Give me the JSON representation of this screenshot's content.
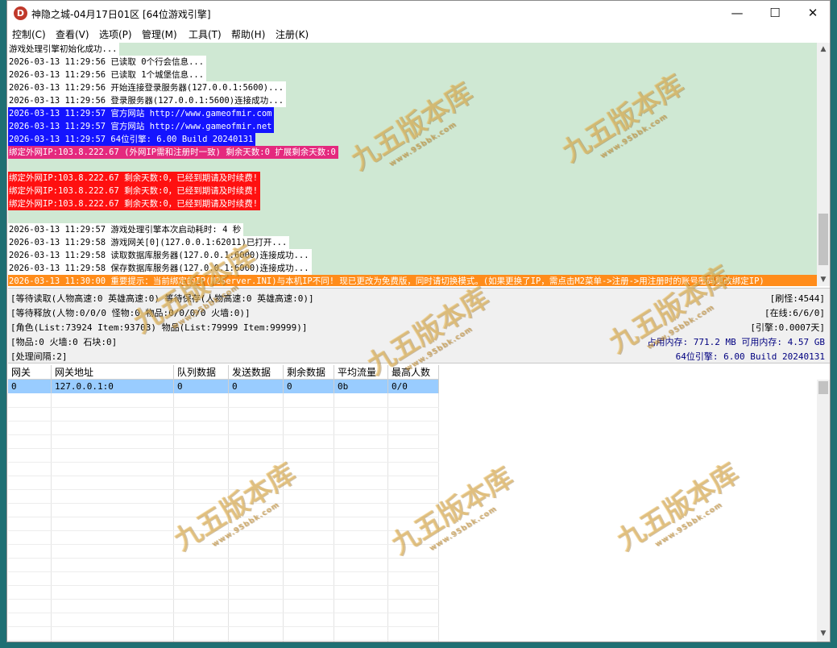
{
  "window": {
    "icon_letter": "D",
    "title": "神隐之城-04月17日01区 [64位游戏引擎]",
    "minimize": "—",
    "maximize": "☐",
    "close": "✕"
  },
  "menu": [
    "控制(C)",
    "查看(V)",
    "选项(P)",
    "管理(M)",
    "工具(T)",
    "帮助(H)",
    "注册(K)"
  ],
  "log_lines": [
    {
      "text": "游戏处理引擎初始化成功...",
      "style": "white"
    },
    {
      "text": "2026-03-13 11:29:56 已读取 0个行会信息...",
      "style": "white"
    },
    {
      "text": "2026-03-13 11:29:56 已读取 1个城堡信息...",
      "style": "white"
    },
    {
      "text": "2026-03-13 11:29:56 开始连接登录服务器(127.0.0.1:5600)...",
      "style": "white"
    },
    {
      "text": "2026-03-13 11:29:56 登录服务器(127.0.0.1:5600)连接成功...",
      "style": "white"
    },
    {
      "text": "2026-03-13 11:29:57 官方网站 http://www.gameofmir.com",
      "style": "blue"
    },
    {
      "text": "2026-03-13 11:29:57 官方网站 http://www.gameofmir.net",
      "style": "blue"
    },
    {
      "text": "2026-03-13 11:29:57 64位引擎: 6.00 Build 20240131",
      "style": "blue"
    },
    {
      "text": "绑定外网IP:103.8.222.67 (外网IP需和注册时一致) 剩余天数:0 扩展剩余天数:0",
      "style": "magenta"
    },
    {
      "text": "",
      "style": "none"
    },
    {
      "text": "绑定外网IP:103.8.222.67 剩余天数:0，已经到期请及时续费!",
      "style": "red"
    },
    {
      "text": "绑定外网IP:103.8.222.67 剩余天数:0，已经到期请及时续费!",
      "style": "red"
    },
    {
      "text": "绑定外网IP:103.8.222.67 剩余天数:0，已经到期请及时续费!",
      "style": "red"
    },
    {
      "text": "",
      "style": "none"
    },
    {
      "text": "2026-03-13 11:29:57 游戏处理引擎本次启动耗时: 4 秒",
      "style": "white"
    },
    {
      "text": "2026-03-13 11:29:58 游戏网关[0](127.0.0.1:62011)已打开...",
      "style": "white"
    },
    {
      "text": "2026-03-13 11:29:58 读取数据库服务器(127.0.0.1:6000)连接成功...",
      "style": "white"
    },
    {
      "text": "2026-03-13 11:29:58 保存数据库服务器(127.0.0.1:6000)连接成功...",
      "style": "white"
    },
    {
      "text": "2026-03-13 11:30:00 重要提示：当前绑定的IP(M2Server.INI)与本机IP不同! 现已更改为免费版，同时请切换模式。(如果更换了IP，需点击M2菜单->注册->用注册时的账号密码更改绑定IP)",
      "style": "orange"
    }
  ],
  "stats": {
    "wait_read": "[等待读取(人物高速:0 英雄高速:0) 等待保存(人物高速:0 英雄高速:0)]",
    "wait_release": "[等待释放(人物:0/0/0 怪物:0 物品:0/0/0/0 火墙:0)]",
    "roles": "[角色(List:73924 Item:93703) 物品(List:79999 Item:99999)]",
    "items": "[物品:0 火墙:0 石块:0]",
    "interval": "[处理间隔:2]",
    "refresh_monster": "[刷怪:4544]",
    "online": "[在线:6/6/0]",
    "engine_stat": "[引擎:0.0007天]",
    "memory": "占用内存: 771.2 MB 可用内存: 4.57 GB",
    "engine_build": "64位引擎: 6.00 Build 20240131"
  },
  "gateway_table": {
    "headers": [
      "网关",
      "网关地址",
      "队列数据",
      "发送数据",
      "剩余数据",
      "平均流量",
      "最高人数"
    ],
    "rows": [
      [
        "0",
        "127.0.0.1:0",
        "0",
        "0",
        "0",
        "0b",
        "0/0"
      ]
    ]
  },
  "watermark": {
    "text": "九五版本库",
    "url": "www.95bbk.com"
  },
  "colors": {
    "log_bg": "#cfe8d3",
    "blue_line": "#1414ff",
    "magenta_line": "#e4297e",
    "red_line": "#ff1010",
    "orange_line": "#ff8c1a",
    "selected_row": "#99ccff"
  }
}
